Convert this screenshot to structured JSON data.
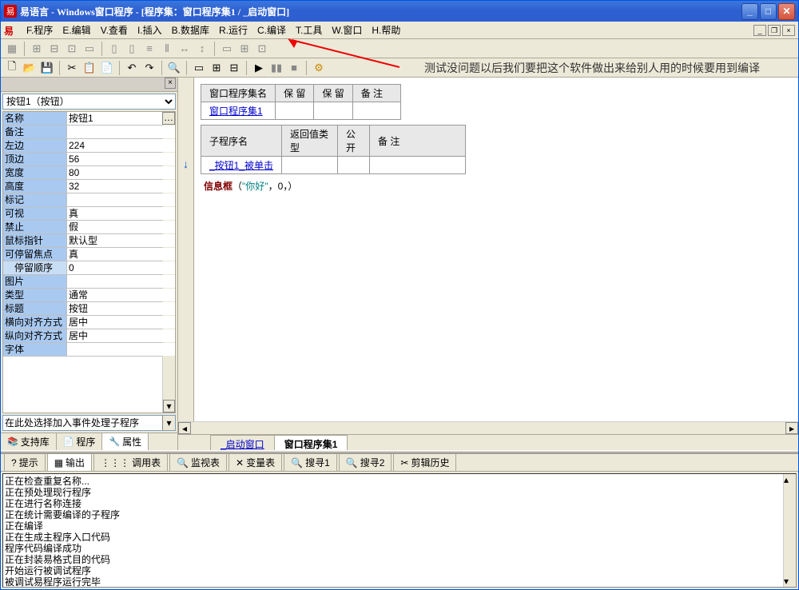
{
  "titlebar": {
    "app_icon": "易",
    "title": "易语言 - Windows窗口程序 - [程序集：窗口程序集1 / _启动窗口]"
  },
  "menu": {
    "items": [
      "F.程序",
      "E.编辑",
      "V.查看",
      "I.插入",
      "B.数据库",
      "R.运行",
      "C.编译",
      "T.工具",
      "W.窗口",
      "H.帮助"
    ]
  },
  "annotation": "测试没问题以后我们要把这个软件做出来给别人用的时候要用到编译",
  "properties": {
    "selector": "按钮1（按钮）",
    "rows": [
      {
        "label": "名称",
        "value": "按钮1",
        "editable": true
      },
      {
        "label": "备注",
        "value": ""
      },
      {
        "label": "左边",
        "value": "224"
      },
      {
        "label": "顶边",
        "value": "56"
      },
      {
        "label": "宽度",
        "value": "80"
      },
      {
        "label": "高度",
        "value": "32"
      },
      {
        "label": "标记",
        "value": ""
      },
      {
        "label": "可视",
        "value": "真"
      },
      {
        "label": "禁止",
        "value": "假"
      },
      {
        "label": "鼠标指针",
        "value": "默认型"
      },
      {
        "label": "可停留焦点",
        "value": "真"
      },
      {
        "label": "停留顺序",
        "value": "0",
        "indent": true
      },
      {
        "label": "图片",
        "value": ""
      },
      {
        "label": "类型",
        "value": "通常"
      },
      {
        "label": "标题",
        "value": "按钮"
      },
      {
        "label": "横向对齐方式",
        "value": "居中"
      },
      {
        "label": "纵向对齐方式",
        "value": "居中"
      },
      {
        "label": "字体",
        "value": ""
      }
    ],
    "event_hint": "在此处选择加入事件处理子程序"
  },
  "left_tabs": [
    {
      "icon": "📚",
      "label": "支持库"
    },
    {
      "icon": "📄",
      "label": "程序"
    },
    {
      "icon": "🔧",
      "label": "属性",
      "active": true
    }
  ],
  "code": {
    "table1": {
      "headers": [
        "窗口程序集名",
        "保 留",
        "保 留",
        "备 注"
      ],
      "row": [
        "窗口程序集1",
        "",
        "",
        ""
      ]
    },
    "table2": {
      "headers": [
        "子程序名",
        "返回值类型",
        "公开",
        "备 注"
      ],
      "row": [
        "_按钮1_被单击",
        "",
        "",
        ""
      ]
    },
    "line": {
      "fn": "信息框",
      "args_open": "（",
      "str": "\"你好\"",
      "sep1": "，",
      "num": "0",
      "sep2": "，",
      "close": "）"
    }
  },
  "code_tabs": [
    {
      "label": "_启动窗口",
      "underline": true
    },
    {
      "label": "窗口程序集1",
      "active": true
    }
  ],
  "bottom_tabs": [
    {
      "icon": "?",
      "label": "提示"
    },
    {
      "icon": "▦",
      "label": "输出",
      "active": true
    },
    {
      "icon": "⋮⋮⋮",
      "label": "调用表"
    },
    {
      "icon": "🔍",
      "label": "监视表"
    },
    {
      "icon": "✕",
      "label": "变量表"
    },
    {
      "icon": "🔍",
      "label": "搜寻1"
    },
    {
      "icon": "🔍",
      "label": "搜寻2"
    },
    {
      "icon": "✂",
      "label": "剪辑历史"
    }
  ],
  "output": [
    "正在检查重复名称...",
    "正在预处理现行程序",
    "正在进行名称连接",
    "正在统计需要编译的子程序",
    "正在编译",
    "正在生成主程序入口代码",
    "程序代码编译成功",
    "正在封装易格式目的代码",
    "开始运行被调试程序",
    "被调试易程序运行完毕"
  ]
}
